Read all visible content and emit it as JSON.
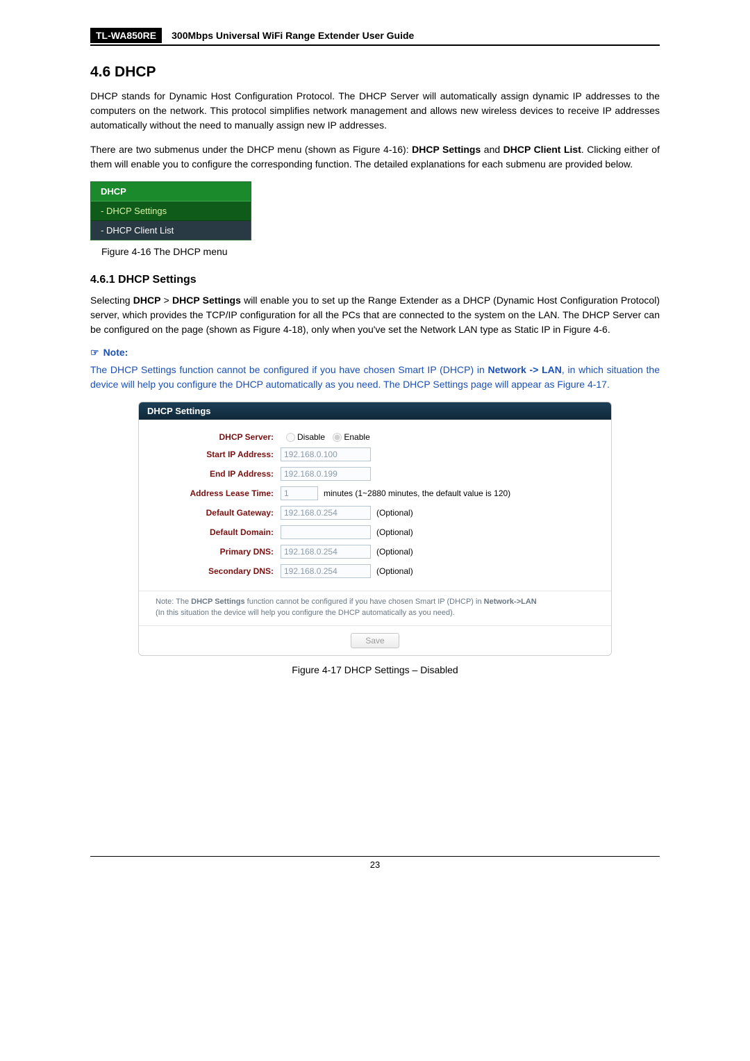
{
  "header": {
    "model": "TL-WA850RE",
    "doc_title": "300Mbps Universal WiFi Range Extender User Guide"
  },
  "section": {
    "num_title": "4.6   DHCP",
    "p1": "DHCP stands for Dynamic Host Configuration Protocol. The DHCP Server will automatically assign dynamic IP addresses to the computers on the network. This protocol simplifies network management and allows new wireless devices to receive IP addresses automatically without the need to manually assign new IP addresses.",
    "p2_a": "There are two submenus under the DHCP menu (shown as Figure 4-16): ",
    "p2_b": "DHCP Settings",
    "p2_c": " and ",
    "p2_d": "DHCP Client List",
    "p2_e": ". Clicking either of them will enable you to configure the corresponding function. The detailed explanations for each submenu are provided below."
  },
  "menu": {
    "header": "DHCP",
    "item1": "- DHCP Settings",
    "item2": "- DHCP Client List"
  },
  "fig1_caption": "Figure 4-16 The DHCP menu",
  "sub": {
    "title": "4.6.1  DHCP Settings",
    "p1_a": "Selecting ",
    "p1_b": "DHCP",
    "p1_c": " > ",
    "p1_d": "DHCP Settings",
    "p1_e": " will enable you to set up the Range Extender as a DHCP (Dynamic Host Configuration Protocol) server, which provides the TCP/IP configuration for all the PCs that are connected to the system on the LAN. The DHCP Server can be configured on the page (shown as Figure 4-18), only when you've set the Network LAN type as Static IP in Figure 4-6."
  },
  "note_label": "Note:",
  "note_text_a": "The DHCP Settings function cannot be configured if you have chosen Smart IP (DHCP) in ",
  "note_text_b": "Network -> LAN",
  "note_text_c": ", in which situation the device will help you configure the DHCP automatically as you need. The DHCP Settings page will appear as Figure 4-17.",
  "panel": {
    "title": "DHCP Settings",
    "labels": {
      "server": "DHCP Server:",
      "start": "Start IP Address:",
      "end": "End IP Address:",
      "lease": "Address Lease Time:",
      "gateway": "Default Gateway:",
      "domain": "Default Domain:",
      "pdns": "Primary DNS:",
      "sdns": "Secondary DNS:"
    },
    "values": {
      "disable": "Disable",
      "enable": "Enable",
      "start": "192.168.0.100",
      "end": "192.168.0.199",
      "lease": "1",
      "lease_hint": "minutes (1~2880 minutes, the default value is 120)",
      "gateway": "192.168.0.254",
      "domain": "",
      "pdns": "192.168.0.254",
      "sdns": "192.168.0.254",
      "optional": "(Optional)"
    },
    "footnote_a": "Note: The ",
    "footnote_b": "DHCP Settings",
    "footnote_c": " function cannot be configured if you have chosen Smart IP (DHCP) in ",
    "footnote_d": "Network->LAN",
    "footnote_e": " (In this situation the device will help you configure the DHCP automatically as you need).",
    "save": "Save"
  },
  "fig2_caption": "Figure 4-17 DHCP Settings – Disabled",
  "page_number": "23"
}
